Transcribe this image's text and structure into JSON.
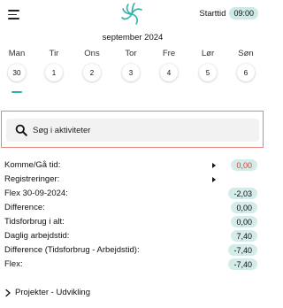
{
  "header": {
    "start_label": "Starttid",
    "start_time": "09:00",
    "icons": [
      "menu-icon",
      "logo-icon"
    ],
    "accent_color": "#2fb3a7"
  },
  "calendar": {
    "month": "september 2024",
    "days": [
      {
        "name": "Man",
        "num": "30"
      },
      {
        "name": "Tir",
        "num": "1"
      },
      {
        "name": "Ons",
        "num": "2"
      },
      {
        "name": "Tor",
        "num": "3"
      },
      {
        "name": "Fre",
        "num": "4"
      },
      {
        "name": "Lør",
        "num": "5"
      },
      {
        "name": "Søn",
        "num": "6"
      }
    ]
  },
  "search": {
    "placeholder": "Søg i aktiviteter"
  },
  "summary": {
    "rows": [
      {
        "label": "Komme/Gå tid:",
        "value": "0,00",
        "arrow": true,
        "color": "#e23b30"
      },
      {
        "label": "Registreringer:",
        "value": "",
        "arrow": true
      },
      {
        "label": "Flex 30-09-2024:",
        "value": "-2,03"
      },
      {
        "label": "Difference:",
        "value": "0,00"
      },
      {
        "label": "Tidsforbrug i alt:",
        "value": "0,00"
      },
      {
        "label": "Daglig arbejdstid:",
        "value": "7,40"
      },
      {
        "label": "Difference (Tidsforbrug - Arbejdstid):",
        "value": "-7,40"
      },
      {
        "label": "Flex:",
        "value": "-7,40"
      }
    ]
  },
  "projects": {
    "label": "Projekter - Udvikling"
  }
}
